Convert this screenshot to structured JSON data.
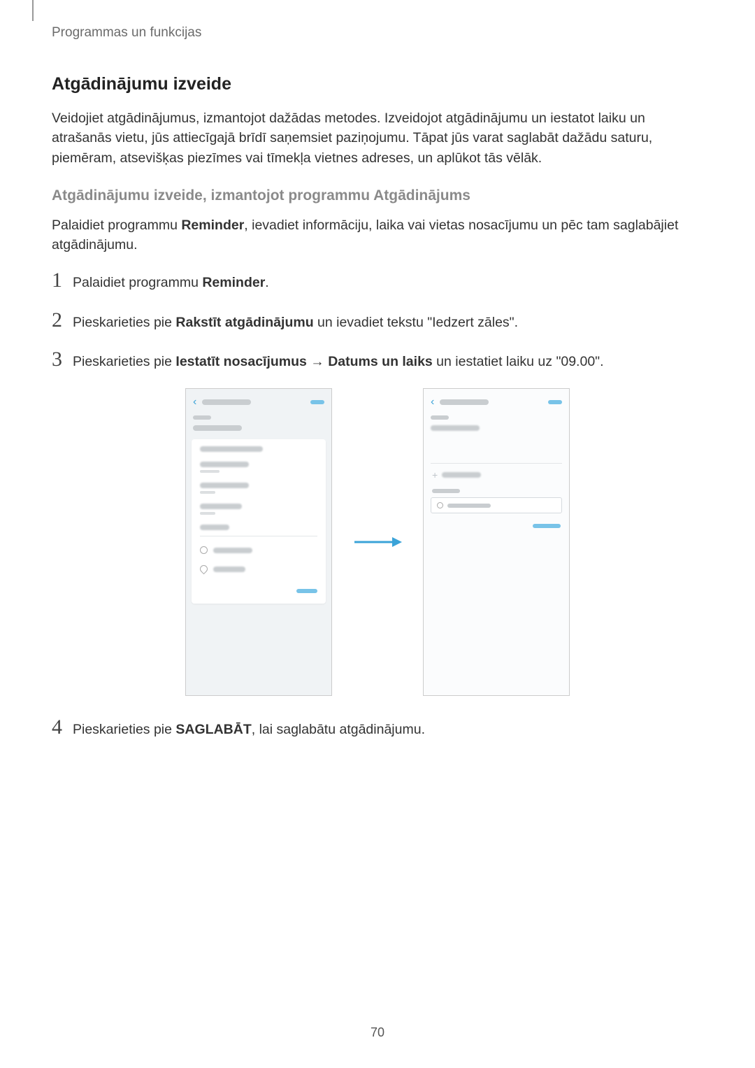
{
  "breadcrumb": "Programmas un funkcijas",
  "heading": "Atgādinājumu izveide",
  "intro": "Veidojiet atgādinājumus, izmantojot dažādas metodes. Izveidojot atgādinājumu un iestatot laiku un atrašanās vietu, jūs attiecīgajā brīdī saņemsiet paziņojumu. Tāpat jūs varat saglabāt dažādu saturu, piemēram, atsevišķas piezīmes vai tīmekļa vietnes adreses, un aplūkot tās vēlāk.",
  "subheading": "Atgādinājumu izveide, izmantojot programmu Atgādinājums",
  "sub_intro_a": "Palaidiet programmu ",
  "sub_intro_b": "Reminder",
  "sub_intro_c": ", ievadiet informāciju, laika vai vietas nosacījumu un pēc tam saglabājiet atgādinājumu.",
  "steps": {
    "s1_a": "Palaidiet programmu ",
    "s1_b": "Reminder",
    "s1_c": ".",
    "s2_a": "Pieskarieties pie ",
    "s2_b": "Rakstīt atgādinājumu",
    "s2_c": " un ievadiet tekstu \"Iedzert zāles\".",
    "s3_a": "Pieskarieties pie ",
    "s3_b": "Iestatīt nosacījumus",
    "s3_arrow": " → ",
    "s3_c": "Datums un laiks",
    "s3_d": " un iestatiet laiku uz \"09.00\".",
    "s4_a": "Pieskarieties pie ",
    "s4_b": "SAGLABĀT",
    "s4_c": ", lai saglabātu atgādinājumu."
  },
  "nums": {
    "n1": "1",
    "n2": "2",
    "n3": "3",
    "n4": "4"
  },
  "page_number": "70"
}
